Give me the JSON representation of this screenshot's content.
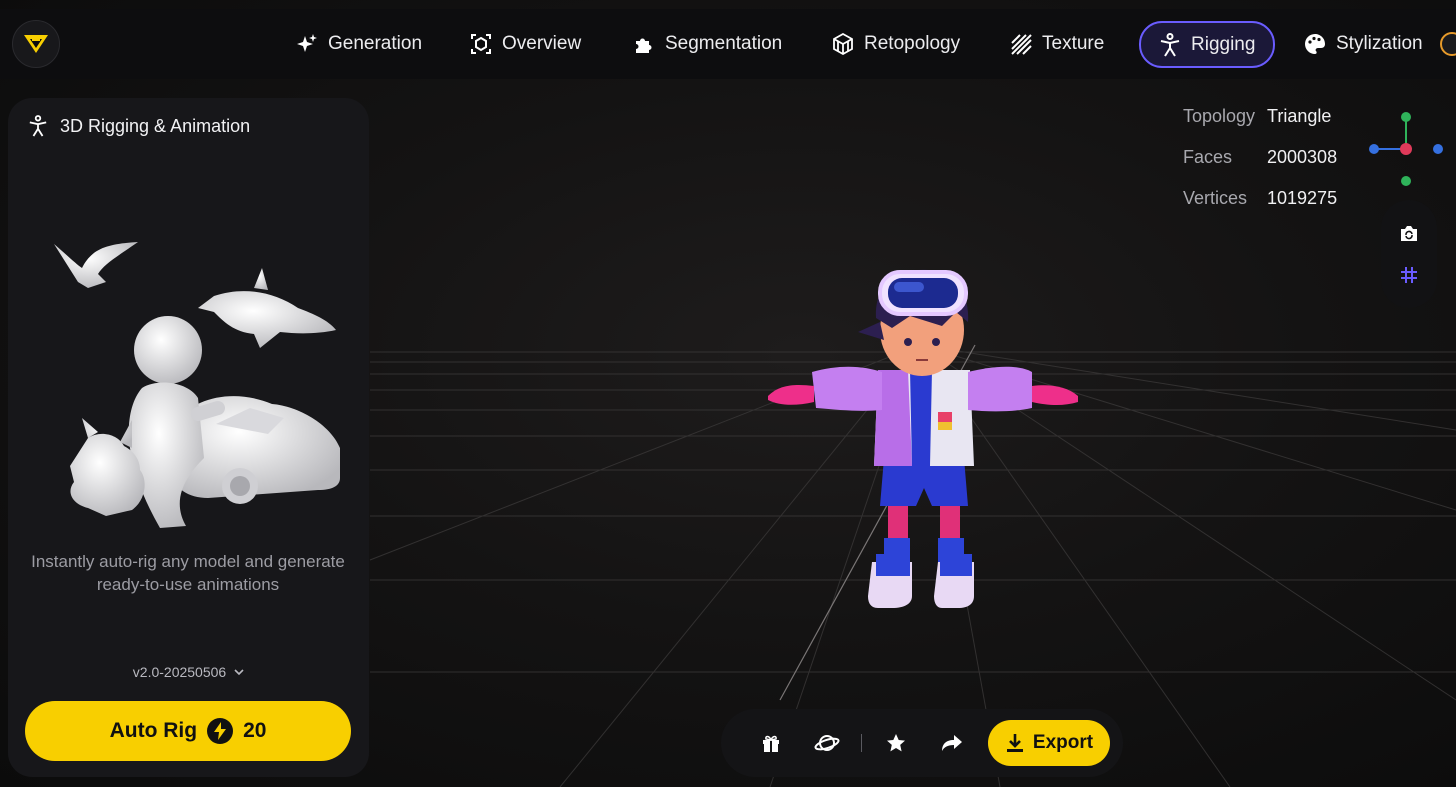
{
  "app": {
    "logo_icon": "vast-logo-icon"
  },
  "nav": {
    "tabs": [
      {
        "label": "Generation",
        "icon": "sparkle-icon"
      },
      {
        "label": "Overview",
        "icon": "cube-focus-icon"
      },
      {
        "label": "Segmentation",
        "icon": "puzzle-icon"
      },
      {
        "label": "Retopology",
        "icon": "mesh-cube-icon"
      },
      {
        "label": "Texture",
        "icon": "stripes-icon"
      },
      {
        "label": "Rigging",
        "icon": "figure-icon",
        "active": true
      },
      {
        "label": "Stylization",
        "icon": "palette-icon"
      }
    ]
  },
  "panel": {
    "title": "3D Rigging & Animation",
    "description": "Instantly auto-rig any model and generate ready-to-use animations",
    "version": "v2.0-20250506",
    "auto_rig_label": "Auto Rig",
    "auto_rig_cost": "20"
  },
  "stats": {
    "topology_label": "Topology",
    "topology_value": "Triangle",
    "faces_label": "Faces",
    "faces_value": "2000308",
    "vertices_label": "Vertices",
    "vertices_value": "1019275"
  },
  "toolbar": {
    "export_label": "Export",
    "icons": [
      "gift-icon",
      "planet-icon",
      "star-icon",
      "share-icon"
    ]
  },
  "colors": {
    "accent": "#f8cf00",
    "active_tab_border": "#6a5cff",
    "panel_bg": "#17171a"
  }
}
